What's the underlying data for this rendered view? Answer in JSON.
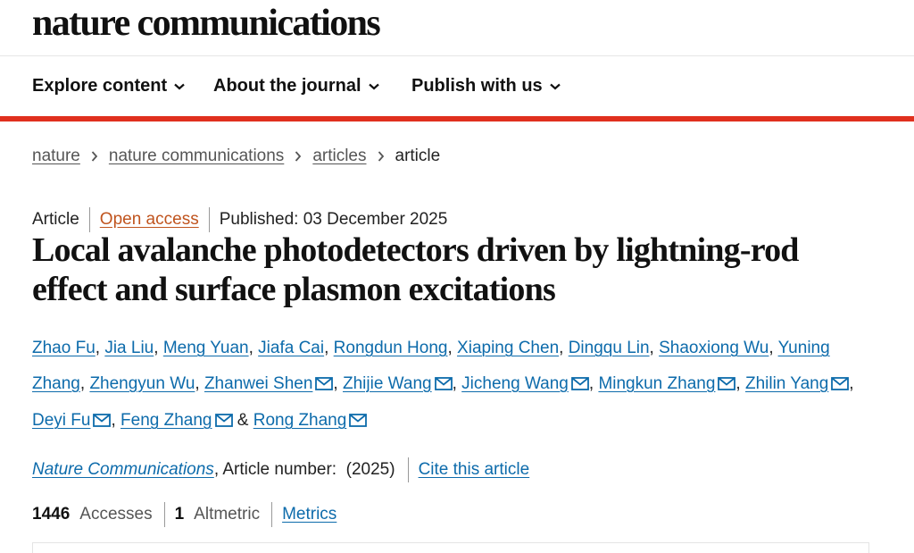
{
  "brand": "nature communications",
  "nav": [
    {
      "label": "Explore content"
    },
    {
      "label": "About the journal"
    },
    {
      "label": "Publish with us"
    }
  ],
  "breadcrumb": [
    {
      "label": "nature"
    },
    {
      "label": "nature communications"
    },
    {
      "label": "articles"
    },
    {
      "label": "article"
    }
  ],
  "meta": {
    "type": "Article",
    "access": "Open access",
    "published": "Published: 03 December 2025"
  },
  "title": "Local avalanche photodetectors driven by lightning-rod effect and surface plasmon excitations",
  "authors": [
    {
      "name": "Zhao Fu",
      "mail": false
    },
    {
      "name": "Jia Liu",
      "mail": false
    },
    {
      "name": "Meng Yuan",
      "mail": false
    },
    {
      "name": "Jiafa Cai",
      "mail": false
    },
    {
      "name": "Rongdun Hong",
      "mail": false
    },
    {
      "name": "Xiaping Chen",
      "mail": false
    },
    {
      "name": "Dingqu Lin",
      "mail": false
    },
    {
      "name": "Shaoxiong Wu",
      "mail": false
    },
    {
      "name": "Yuning Zhang",
      "mail": false
    },
    {
      "name": "Zhengyun Wu",
      "mail": false
    },
    {
      "name": "Zhanwei Shen",
      "mail": true
    },
    {
      "name": "Zhijie Wang",
      "mail": true
    },
    {
      "name": "Jicheng Wang",
      "mail": true
    },
    {
      "name": "Mingkun Zhang",
      "mail": true
    },
    {
      "name": "Zhilin Yang",
      "mail": true
    },
    {
      "name": "Deyi Fu",
      "mail": true
    },
    {
      "name": "Feng Zhang",
      "mail": true
    },
    {
      "name": "Rong Zhang",
      "mail": true
    }
  ],
  "journal": {
    "name": "Nature Communications",
    "article_number": ", Article number:  (2025)",
    "cite": "Cite this article"
  },
  "metrics": {
    "accesses_count": "1446",
    "accesses_label": "Accesses",
    "altmetric_count": "1",
    "altmetric_label": "Altmetric",
    "metrics_link": "Metrics"
  },
  "colors": {
    "accent": "#e0301e",
    "link": "#0d6bab",
    "open_access": "#c0541e"
  },
  "icons": {
    "nav_chevron": "chevron-down-icon",
    "breadcrumb_separator": "chevron-right-icon",
    "author_contact": "mail-icon"
  }
}
